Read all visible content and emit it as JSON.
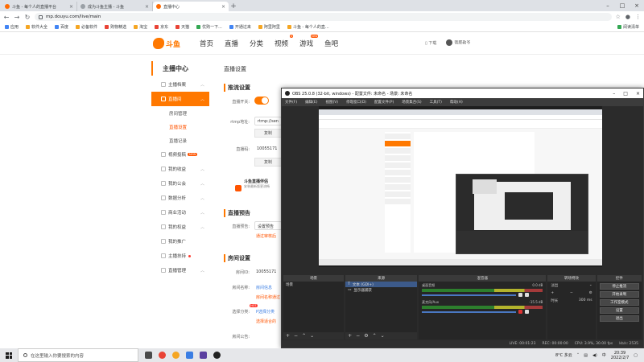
{
  "browser": {
    "tabs": [
      {
        "title": "斗鱼 - 每个人的直播平台",
        "active": false
      },
      {
        "title": "成为斗鱼主播 - 斗鱼",
        "active": false
      },
      {
        "title": "直播中心",
        "active": true
      }
    ],
    "url": "mp.douyu.com/live/main",
    "bookmarks": [
      "应用",
      "软件大全",
      "百度",
      "必备软件",
      "购物精选",
      "淘宝",
      "京东",
      "天猫",
      "优购一下...",
      "开通过来",
      "阿里阿里",
      "斗鱼 - 每个人的直..."
    ],
    "bookmarks_right": "阅读清单"
  },
  "site": {
    "logo_text": "斗鱼",
    "nav": [
      {
        "label": "首页",
        "badge": ""
      },
      {
        "label": "直播",
        "badge": ""
      },
      {
        "label": "分类",
        "badge": ""
      },
      {
        "label": "视频",
        "badge": "4"
      },
      {
        "label": "游戏",
        "badge": "new"
      },
      {
        "label": "鱼吧",
        "badge": ""
      }
    ],
    "download": "下载",
    "username": "斋肥勒爷"
  },
  "sidebar": {
    "title": "主播中心",
    "items": [
      {
        "label": "主播档案",
        "active": false,
        "badge": "",
        "dot": false
      },
      {
        "label": "直播间",
        "active": true,
        "badge": "",
        "dot": false
      },
      {
        "label": "视频投稿",
        "active": false,
        "badge": "NEW",
        "dot": false
      },
      {
        "label": "我的收益",
        "active": false,
        "badge": "",
        "dot": false
      },
      {
        "label": "我的公会",
        "active": false,
        "badge": "",
        "dot": false
      },
      {
        "label": "数据分析",
        "active": false,
        "badge": "",
        "dot": false
      },
      {
        "label": "商业活动",
        "active": false,
        "badge": "",
        "dot": false
      },
      {
        "label": "我的权益",
        "active": false,
        "badge": "",
        "dot": false
      },
      {
        "label": "我的推广",
        "active": false,
        "badge": "",
        "dot": false
      },
      {
        "label": "主播扶持",
        "active": false,
        "badge": "",
        "dot": true
      },
      {
        "label": "直播管理",
        "active": false,
        "badge": "",
        "dot": false
      }
    ],
    "sub_items": [
      {
        "label": "房间管理",
        "current": false
      },
      {
        "label": "直播设置",
        "current": true
      },
      {
        "label": "直播记录",
        "current": false
      }
    ]
  },
  "main": {
    "page_title": "直播设置",
    "section_push": "推流设置",
    "live_switch_label": "直播开关:",
    "rtmp_label": "rtmp地址:",
    "rtmp_value": "rtmp://sen",
    "copy_label": "复制",
    "code_label": "直播码:",
    "code_value": "10055171",
    "promo_title": "斗鱼直播伴侣",
    "promo_sub": "安装最新版更流畅",
    "section_preview": "直播预告",
    "preview_label": "直播预告:",
    "preview_input": "设置预告",
    "preview_tip": "通过审核后",
    "section_room": "房间设置",
    "room_id_label": "房间ID:",
    "room_id_value": "10055171",
    "room_name_label": "房间名称:",
    "room_name_link": "房间信息",
    "room_name_tip": "房间名称通过",
    "room_cat_label": "选择分类:",
    "room_cat_hot": "HOT",
    "room_cat_link": "P选择分类",
    "room_cat_tip": "选择适合的",
    "room_notice_label": "房间公告:"
  },
  "obs": {
    "title": "OBS 25.0.8 (32-bit, windows) - 配置文件: 未命名 - 场景: 未命名",
    "menu": [
      "文件(F)",
      "编辑(E)",
      "视图(V)",
      "停靠窗口(D)",
      "配置文件(P)",
      "场景集合(S)",
      "工具(T)",
      "帮助(H)"
    ],
    "docks": {
      "scenes": {
        "title": "场景",
        "items": [
          "场景"
        ]
      },
      "sources": {
        "title": "来源",
        "items": [
          "文本 (GDI+)",
          "显示器捕获"
        ]
      },
      "mixer": {
        "title": "混音器",
        "channels": [
          {
            "name": "桌面音频",
            "level": "0.0 dB",
            "muted": false
          },
          {
            "name": "麦克风/Aux",
            "level": "-15.5 dB",
            "muted": true
          }
        ]
      },
      "transitions": {
        "title": "转场特效",
        "type": "淡出",
        "duration_label": "时长",
        "duration_value": "300 ms"
      },
      "controls": {
        "title": "控件",
        "buttons": [
          "停止推流",
          "开始录制",
          "工作室模式",
          "设置",
          "退出"
        ]
      }
    },
    "status": {
      "live": "LIVE: 00:01:23",
      "rec": "REC: 00:00:00",
      "cpu": "CPU: 3.9%, 30.00 fps",
      "bitrate": "kb/s: 2535"
    }
  },
  "taskbar": {
    "search_placeholder": "在这里输入你要搜索的内容",
    "weather": "8°C 多云",
    "ime": "中",
    "time": "20:39",
    "date": "2022/2/7"
  }
}
